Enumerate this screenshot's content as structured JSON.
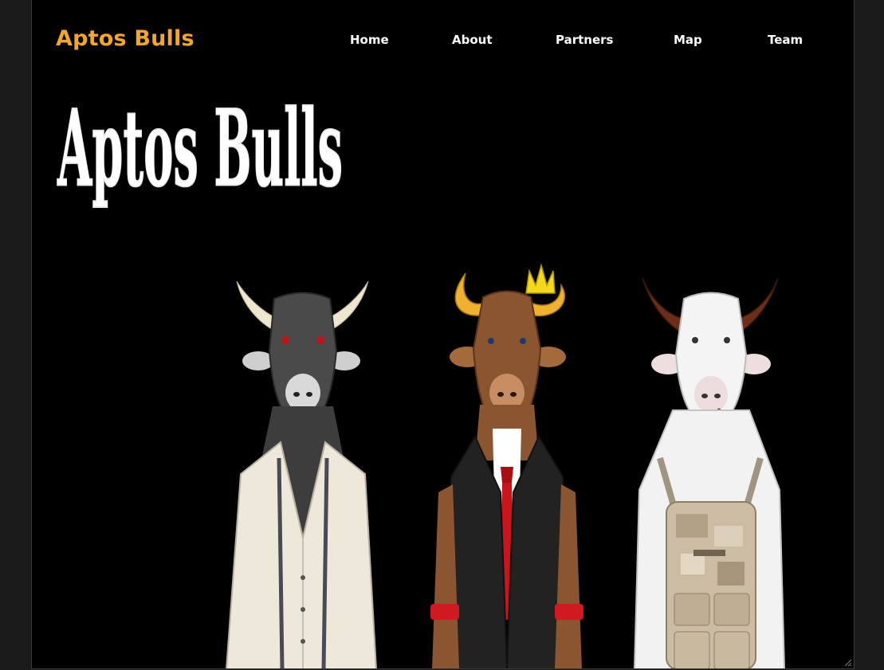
{
  "header": {
    "brand": "Aptos Bulls",
    "brand_color": "#f5a623"
  },
  "nav": {
    "items": [
      {
        "label": "Home"
      },
      {
        "label": "About"
      },
      {
        "label": "Partners"
      },
      {
        "label": "Map"
      },
      {
        "label": "Team"
      }
    ]
  },
  "hero": {
    "title": "Aptos Bulls",
    "title_color": "#ffffff",
    "characters": [
      {
        "name": "dark-bull-white-jacket-icon"
      },
      {
        "name": "brown-bull-crown-suit-icon"
      },
      {
        "name": "white-bull-pipe-backpack-icon"
      }
    ]
  },
  "colors": {
    "page_background": "#000000",
    "outer_background": "#1b1b1b"
  }
}
